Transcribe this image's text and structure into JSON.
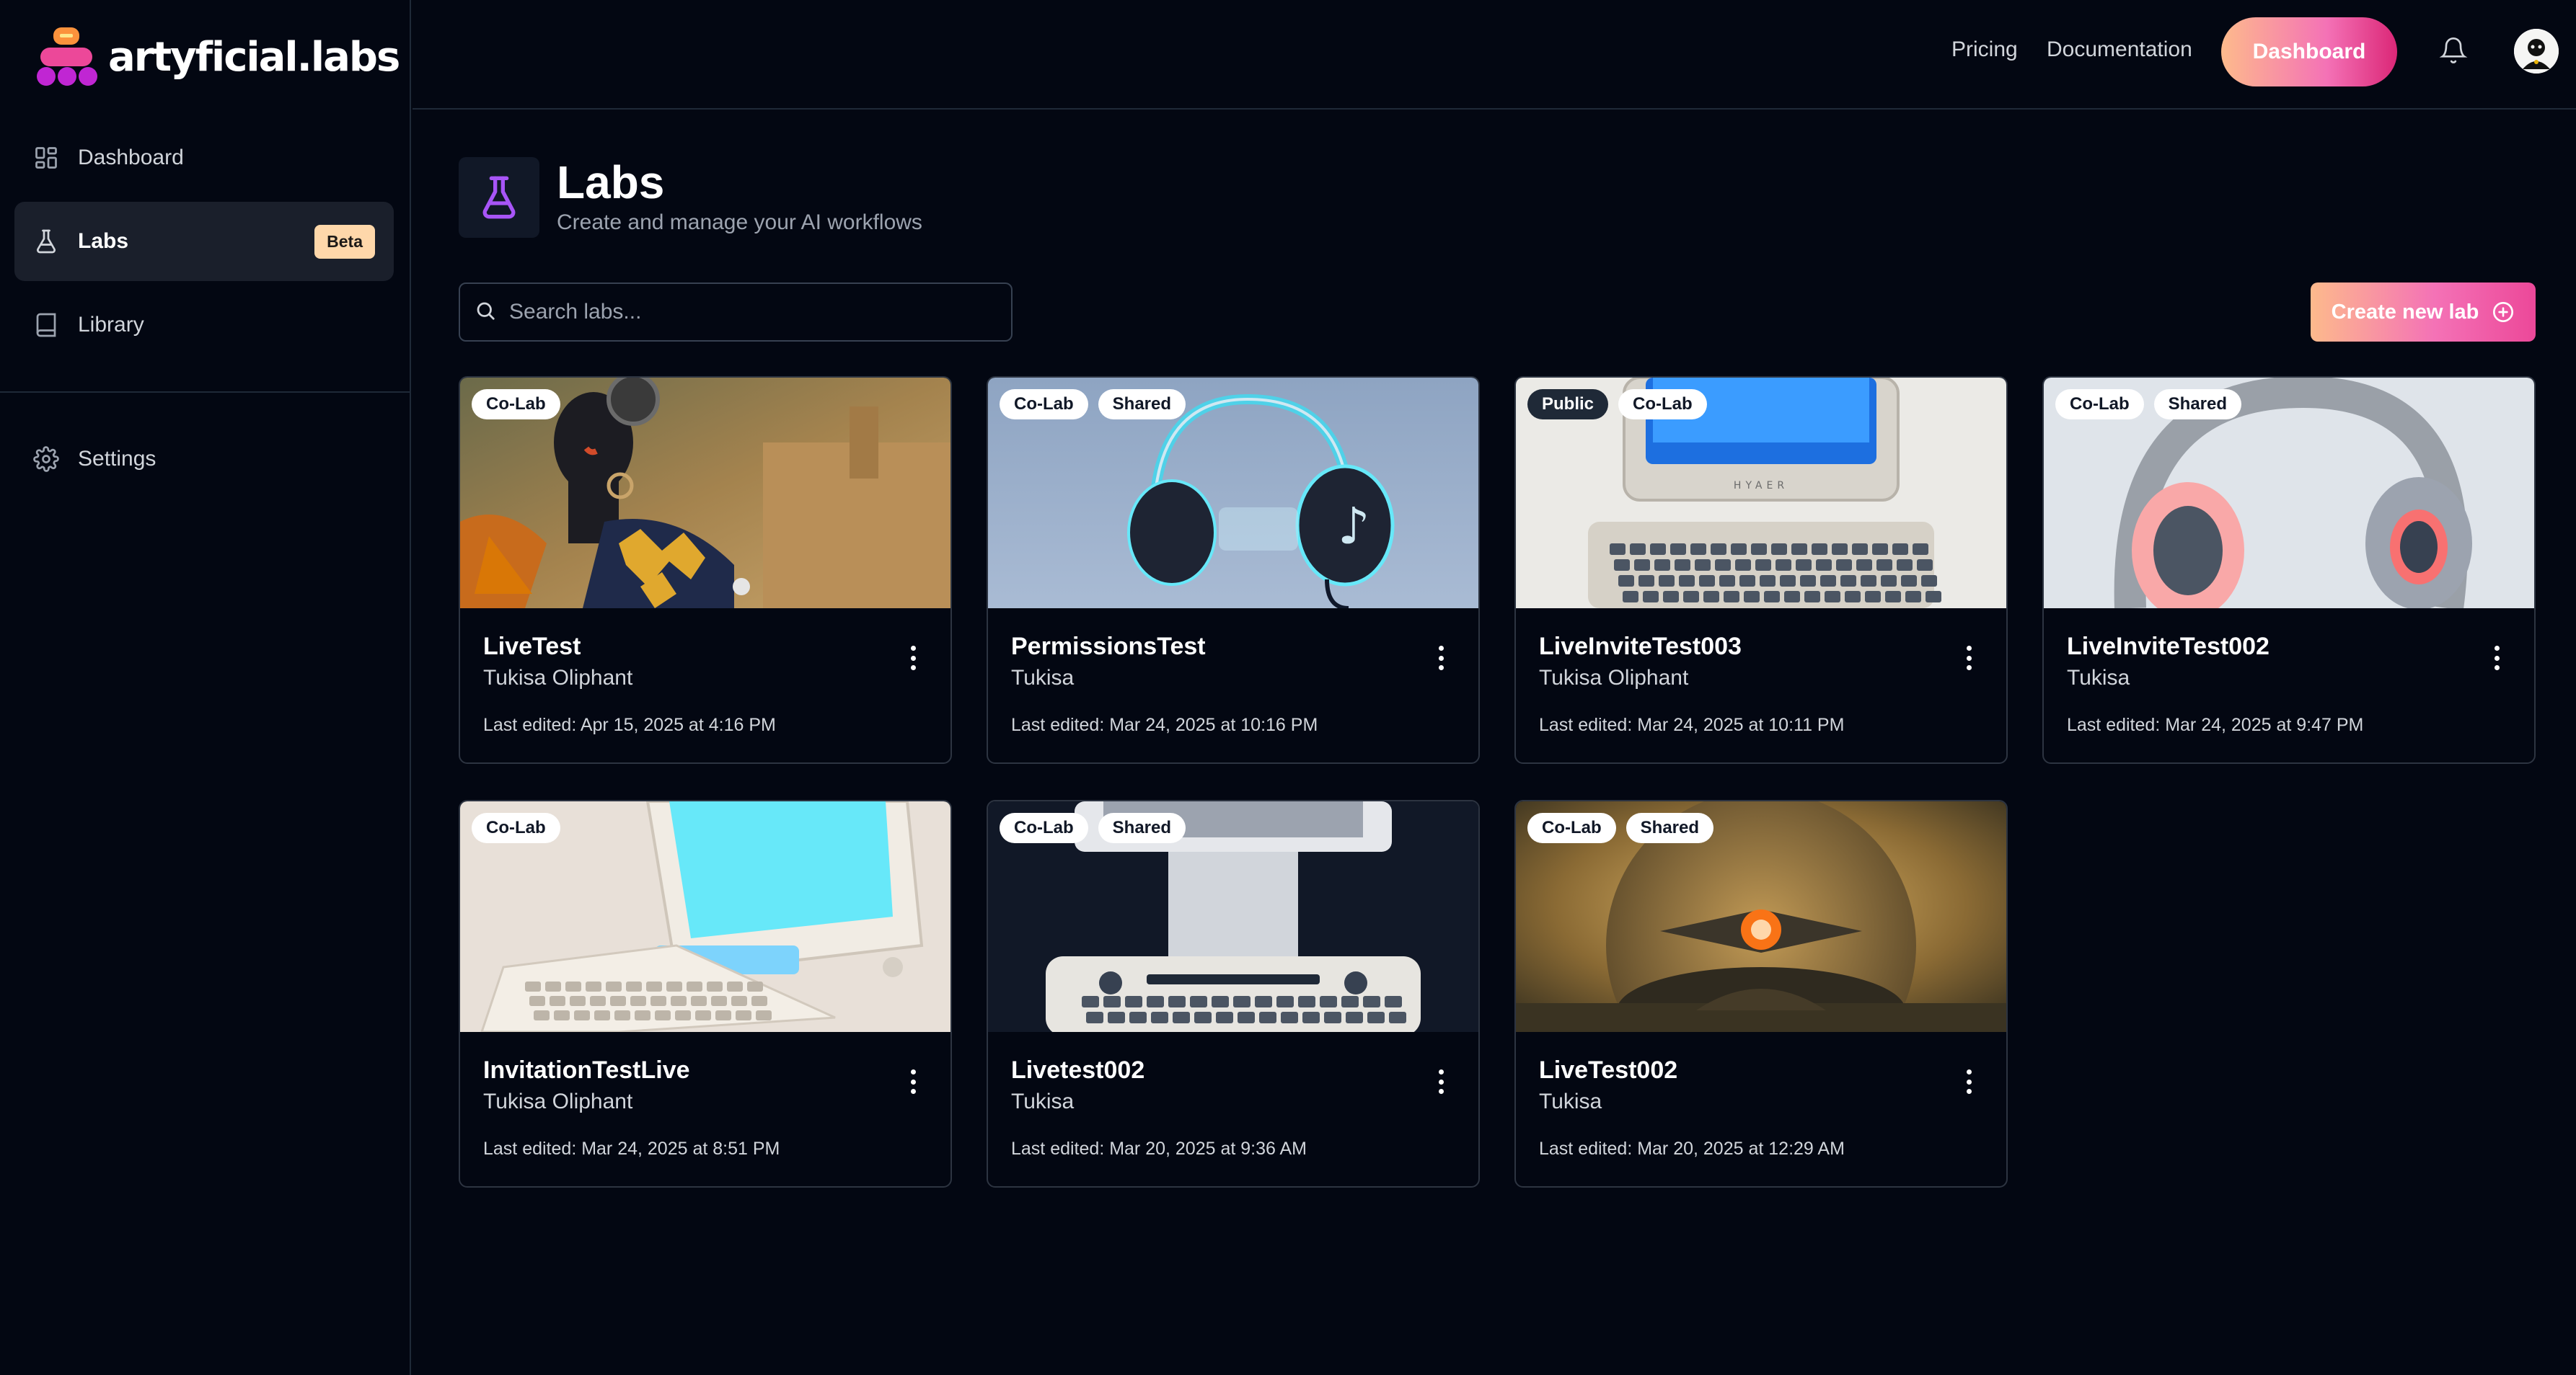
{
  "brand": {
    "name": "artyficial.labs"
  },
  "sidebar": {
    "items": [
      {
        "label": "Dashboard",
        "icon": "dashboard-grid-icon"
      },
      {
        "label": "Labs",
        "icon": "flask-icon",
        "badge": "Beta",
        "active": true
      },
      {
        "label": "Library",
        "icon": "book-icon"
      },
      {
        "label": "Settings",
        "icon": "gear-icon"
      }
    ]
  },
  "topbar": {
    "links": [
      "Pricing",
      "Documentation"
    ],
    "dashboard_button": "Dashboard",
    "notification_icon": "bell-icon"
  },
  "page": {
    "title": "Labs",
    "subtitle": "Create and manage your AI workflows",
    "icon": "flask-icon"
  },
  "search": {
    "placeholder": "Search labs...",
    "value": ""
  },
  "create_button": {
    "label": "Create new lab",
    "icon": "plus-circle-icon"
  },
  "labs": [
    {
      "title": "LiveTest",
      "owner": "Tukisa Oliphant",
      "edited": "Last edited: Apr 15, 2025 at 4:16 PM",
      "badges": [
        "Co-Lab"
      ]
    },
    {
      "title": "PermissionsTest",
      "owner": "Tukisa",
      "edited": "Last edited: Mar 24, 2025 at 10:16 PM",
      "badges": [
        "Co-Lab",
        "Shared"
      ]
    },
    {
      "title": "LiveInviteTest003",
      "owner": "Tukisa Oliphant",
      "edited": "Last edited: Mar 24, 2025 at 10:11 PM",
      "badges": [
        "Public",
        "Co-Lab"
      ]
    },
    {
      "title": "LiveInviteTest002",
      "owner": "Tukisa",
      "edited": "Last edited: Mar 24, 2025 at 9:47 PM",
      "badges": [
        "Co-Lab",
        "Shared"
      ]
    },
    {
      "title": "InvitationTestLive",
      "owner": "Tukisa Oliphant",
      "edited": "Last edited: Mar 24, 2025 at 8:51 PM",
      "badges": [
        "Co-Lab"
      ]
    },
    {
      "title": "Livetest002",
      "owner": "Tukisa",
      "edited": "Last edited: Mar 20, 2025 at 9:36 AM",
      "badges": [
        "Co-Lab",
        "Shared"
      ]
    },
    {
      "title": "LiveTest002",
      "owner": "Tukisa",
      "edited": "Last edited: Mar 20, 2025 at 12:29 AM",
      "badges": [
        "Co-Lab",
        "Shared"
      ]
    }
  ],
  "thumb_texts": {
    "keyboard_brand": "HYAER"
  },
  "colors": {
    "background": "#030712",
    "accent_from": "#fdba8c",
    "accent_to": "#ec4899",
    "beta_badge": "#fed7aa",
    "flask_purple": "#a855f7"
  }
}
